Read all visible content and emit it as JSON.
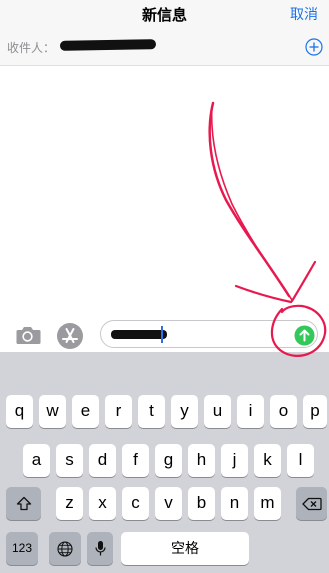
{
  "header": {
    "title": "新信息",
    "cancel_label": "取消"
  },
  "recipient": {
    "label": "收件人："
  },
  "compose": {},
  "keyboard": {
    "row1": [
      "q",
      "w",
      "e",
      "r",
      "t",
      "y",
      "u",
      "i",
      "o",
      "p"
    ],
    "row2": [
      "a",
      "s",
      "d",
      "f",
      "g",
      "h",
      "j",
      "k",
      "l"
    ],
    "row3": [
      "z",
      "x",
      "c",
      "v",
      "b",
      "n",
      "m"
    ],
    "numbers_label": "123",
    "space_label": "空格"
  },
  "colors": {
    "accent": "#1a73e8",
    "send": "#34c759",
    "annotation": "#e8194f",
    "keyboard_bg": "#d1d3d8"
  }
}
